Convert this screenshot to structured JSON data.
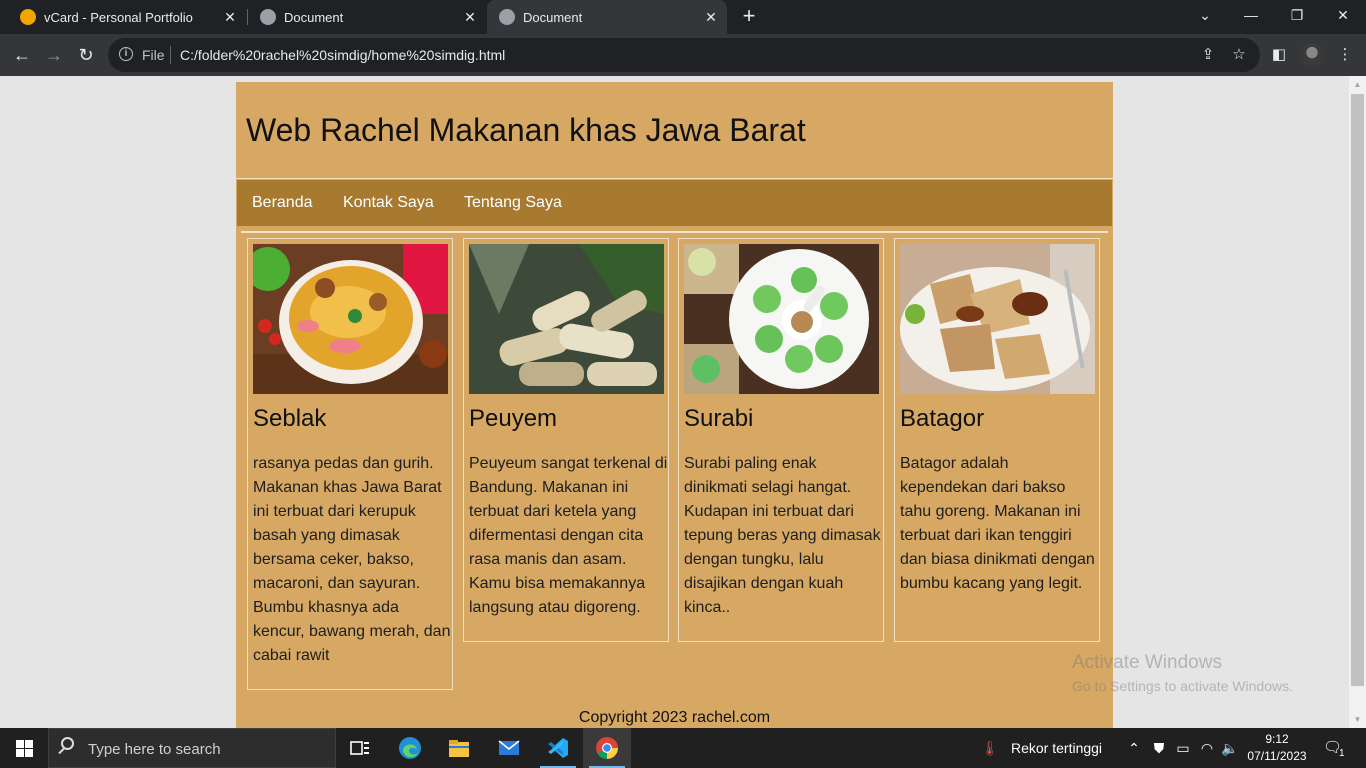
{
  "browser": {
    "tabs": [
      {
        "title": "vCard - Personal Portfolio",
        "favicon_color": "#f0a500",
        "active": false
      },
      {
        "title": "Document",
        "favicon_color": "#9aa0a6",
        "active": false
      },
      {
        "title": "Document",
        "favicon_color": "#9aa0a6",
        "active": true
      }
    ],
    "address": {
      "scheme_label": "File",
      "url": "C:/folder%20rachel%20simdig/home%20simdig.html"
    }
  },
  "page": {
    "header_title": "Web Rachel Makanan khas Jawa Barat",
    "nav": [
      "Beranda",
      "Kontak Saya",
      "Tentang Saya"
    ],
    "cards": [
      {
        "title": "Seblak",
        "text": "rasanya pedas dan gurih. Makanan khas Jawa Barat ini terbuat dari kerupuk basah yang dimasak bersama ceker, bakso, macaroni, dan sayuran. Bumbu khasnya ada kencur, bawang merah, dan cabai rawit"
      },
      {
        "title": "Peuyem",
        "text": "Peuyeum sangat terkenal di Bandung. Makanan ini terbuat dari ketela yang difermentasi dengan cita rasa manis dan asam. Kamu bisa memakannya langsung atau digoreng."
      },
      {
        "title": "Surabi",
        "text": "Surabi paling enak dinikmati selagi hangat. Kudapan ini terbuat dari tepung beras yang dimasak dengan tungku, lalu disajikan dengan kuah kinca.."
      },
      {
        "title": "Batagor",
        "text": "Batagor adalah kependekan dari bakso tahu goreng. Makanan ini terbuat dari ikan tenggiri dan biasa dinikmati dengan bumbu kacang yang legit."
      }
    ],
    "footer": "Copyright 2023 rachel.com",
    "colors": {
      "page_bg": "#d6a864",
      "nav_bg": "#a77a30",
      "border": "#f0dfbf"
    }
  },
  "watermark": {
    "line1": "Activate Windows",
    "line2": "Go to Settings to activate Windows."
  },
  "taskbar": {
    "search_placeholder": "Type here to search",
    "apps": [
      "task-view",
      "edge",
      "file-explorer",
      "mail",
      "vscode",
      "chrome"
    ],
    "weather_text": "Rekor tertinggi",
    "time": "9:12",
    "date": "07/11/2023",
    "notification_count": "1"
  }
}
